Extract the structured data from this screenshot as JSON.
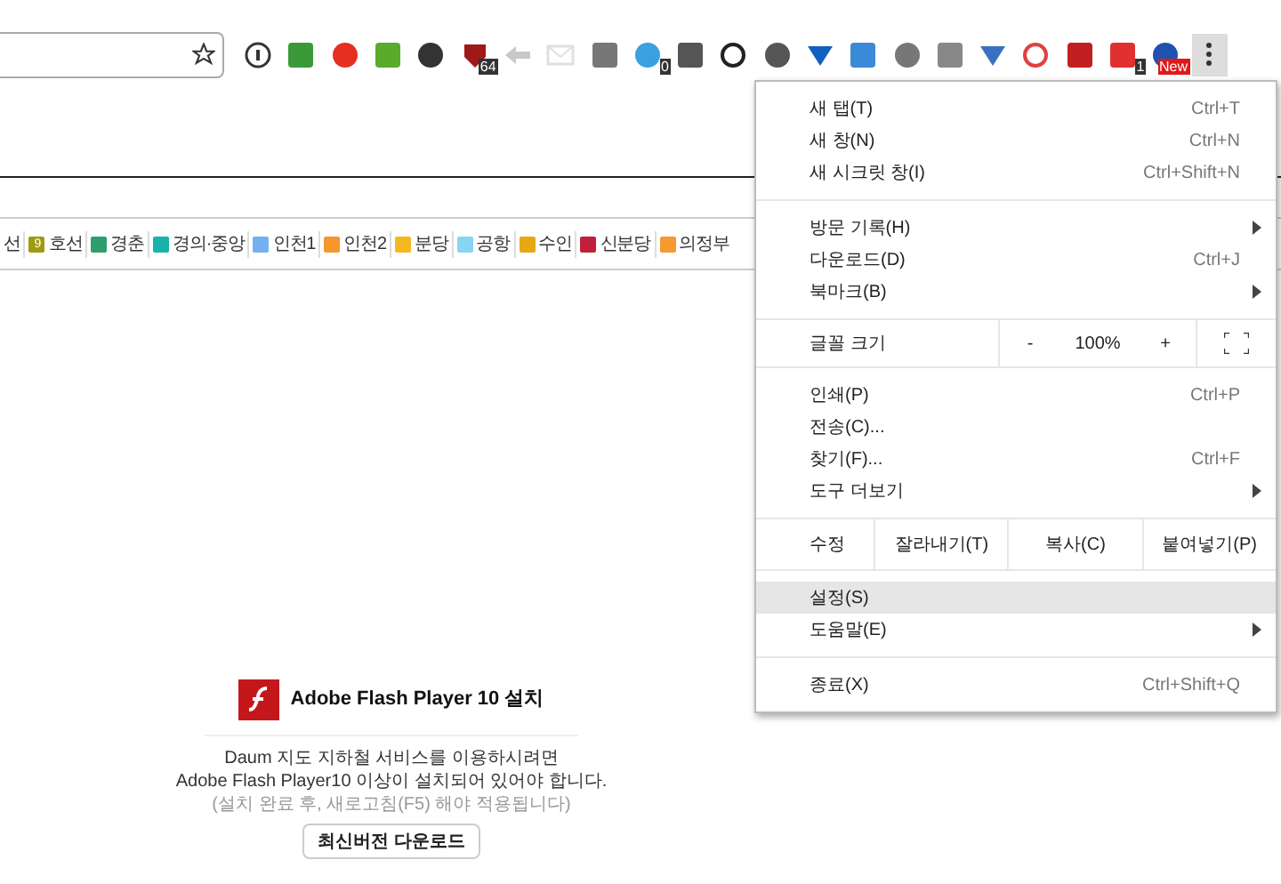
{
  "extension_badges": [
    {
      "text": "64"
    },
    {
      "text": "0"
    },
    {
      "text": "1"
    },
    {
      "text": "New"
    }
  ],
  "subway_legend": [
    {
      "label": "선"
    },
    {
      "label": "호선",
      "color": "#a09a10",
      "mark": "9"
    },
    {
      "label": "경춘",
      "color": "#2f9e6e"
    },
    {
      "label": "경의·중앙",
      "color": "#18b4a8"
    },
    {
      "label": "인천1",
      "color": "#74b0f0"
    },
    {
      "label": "인천2",
      "color": "#f7962b"
    },
    {
      "label": "분당",
      "color": "#f5b823"
    },
    {
      "label": "공항",
      "color": "#88d4f5"
    },
    {
      "label": "수인",
      "color": "#e8a812"
    },
    {
      "label": "신분당",
      "color": "#c0203a"
    },
    {
      "label": "의정부",
      "color": "#f59a30"
    }
  ],
  "menu": {
    "items": [
      {
        "kind": "item",
        "label": "새 탭(T)",
        "shortcut": "Ctrl+T",
        "submenu": false,
        "selected": false
      },
      {
        "kind": "item",
        "label": "새 창(N)",
        "shortcut": "Ctrl+N",
        "submenu": false,
        "selected": false
      },
      {
        "kind": "item",
        "label": "새 시크릿 창(I)",
        "shortcut": "Ctrl+Shift+N",
        "submenu": false,
        "selected": false
      },
      {
        "kind": "separator"
      },
      {
        "kind": "item",
        "label": "방문 기록(H)",
        "submenu": true,
        "selected": false
      },
      {
        "kind": "item",
        "label": "다운로드(D)",
        "shortcut": "Ctrl+J",
        "submenu": false,
        "selected": false
      },
      {
        "kind": "item",
        "label": "북마크(B)",
        "submenu": true,
        "selected": false
      },
      {
        "kind": "separator"
      },
      {
        "kind": "zoom",
        "label": "글꼴 크기",
        "minus": "-",
        "value": "100%",
        "plus": "+"
      },
      {
        "kind": "separator"
      },
      {
        "kind": "item",
        "label": "인쇄(P)",
        "shortcut": "Ctrl+P",
        "submenu": false,
        "selected": false
      },
      {
        "kind": "item",
        "label": "전송(C)...",
        "submenu": false,
        "selected": false
      },
      {
        "kind": "item",
        "label": "찾기(F)...",
        "shortcut": "Ctrl+F",
        "submenu": false,
        "selected": false
      },
      {
        "kind": "item",
        "label": "도구 더보기",
        "submenu": true,
        "selected": false
      },
      {
        "kind": "separator"
      },
      {
        "kind": "edit",
        "label": "수정",
        "buttons": [
          "잘라내기(T)",
          "복사(C)",
          "붙여넣기(P)"
        ]
      },
      {
        "kind": "separator"
      },
      {
        "kind": "item",
        "label": "설정(S)",
        "submenu": false,
        "selected": true
      },
      {
        "kind": "item",
        "label": "도움말(E)",
        "submenu": true,
        "selected": false
      },
      {
        "kind": "separator"
      },
      {
        "kind": "item",
        "label": "종료(X)",
        "shortcut": "Ctrl+Shift+Q",
        "submenu": false,
        "selected": false
      }
    ]
  },
  "flash": {
    "title": "Adobe Flash Player 10 설치",
    "lines": [
      "Daum 지도 지하철 서비스를 이용하시려면",
      "Adobe Flash Player10 이상이 설치되어 있어야 합니다."
    ],
    "note": "(설치 완료 후, 새로고침(F5) 해야 적용됩니다)",
    "button": "최신버전 다운로드"
  }
}
